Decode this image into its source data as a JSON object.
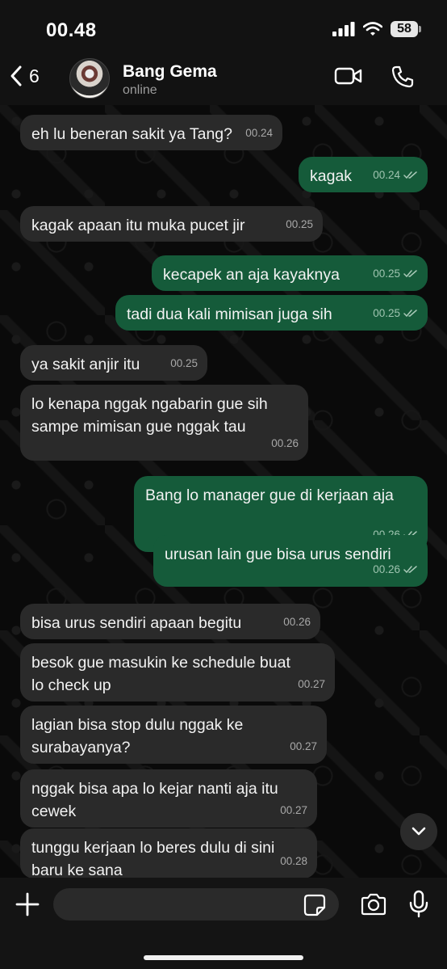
{
  "status_bar": {
    "time": "00.48",
    "battery": "58"
  },
  "header": {
    "back_count": "6",
    "contact_name": "Bang Gema",
    "contact_status": "online"
  },
  "messages": [
    {
      "dir": "in",
      "text": [
        "eh lu beneran sakit ya Tang?"
      ],
      "time": "00.24"
    },
    {
      "dir": "out",
      "text": [
        "kagak"
      ],
      "time": "00.24",
      "read": true
    },
    {
      "dir": "in",
      "text": [
        "kagak apaan itu muka pucet jir"
      ],
      "time": "00.25"
    },
    {
      "dir": "out",
      "text": [
        "kecapek an aja kayaknya"
      ],
      "time": "00.25",
      "read": true
    },
    {
      "dir": "out",
      "text": [
        "tadi dua kali mimisan juga sih"
      ],
      "time": "00.25",
      "read": true
    },
    {
      "dir": "in",
      "text": [
        "ya sakit anjir itu"
      ],
      "time": "00.25"
    },
    {
      "dir": "in",
      "text": [
        "lo kenapa nggak ngabarin gue sih",
        "sampe mimisan gue nggak tau"
      ],
      "time": "00.26"
    },
    {
      "dir": "out",
      "text": [
        "Bang lo manager gue di kerjaan aja"
      ],
      "time": "00.26",
      "read": true
    },
    {
      "dir": "out",
      "text": [
        "urusan lain gue bisa urus sendiri"
      ],
      "time": "00.26",
      "read": true
    },
    {
      "dir": "in",
      "text": [
        "bisa urus sendiri apaan begitu"
      ],
      "time": "00.26"
    },
    {
      "dir": "in",
      "text": [
        "besok gue masukin ke schedule buat",
        "lo check up"
      ],
      "time": "00.27"
    },
    {
      "dir": "in",
      "text": [
        "lagian bisa stop dulu nggak ke",
        "surabayanya?"
      ],
      "time": "00.27"
    },
    {
      "dir": "in",
      "text": [
        "nggak bisa apa lo kejar nanti aja itu",
        "cewek"
      ],
      "time": "00.27"
    },
    {
      "dir": "in",
      "text": [
        "tunggu kerjaan lo beres dulu di sini",
        "baru ke sana"
      ],
      "time": "00.28"
    }
  ],
  "input": {
    "placeholder": ""
  },
  "colors": {
    "incoming": "#2a2a2a",
    "outgoing": "#155b3a",
    "background": "#0a0a0a"
  },
  "icons": [
    "back-chevron-icon",
    "video-call-icon",
    "phone-icon",
    "scroll-down-icon",
    "plus-icon",
    "sticker-icon",
    "camera-icon",
    "microphone-icon"
  ]
}
